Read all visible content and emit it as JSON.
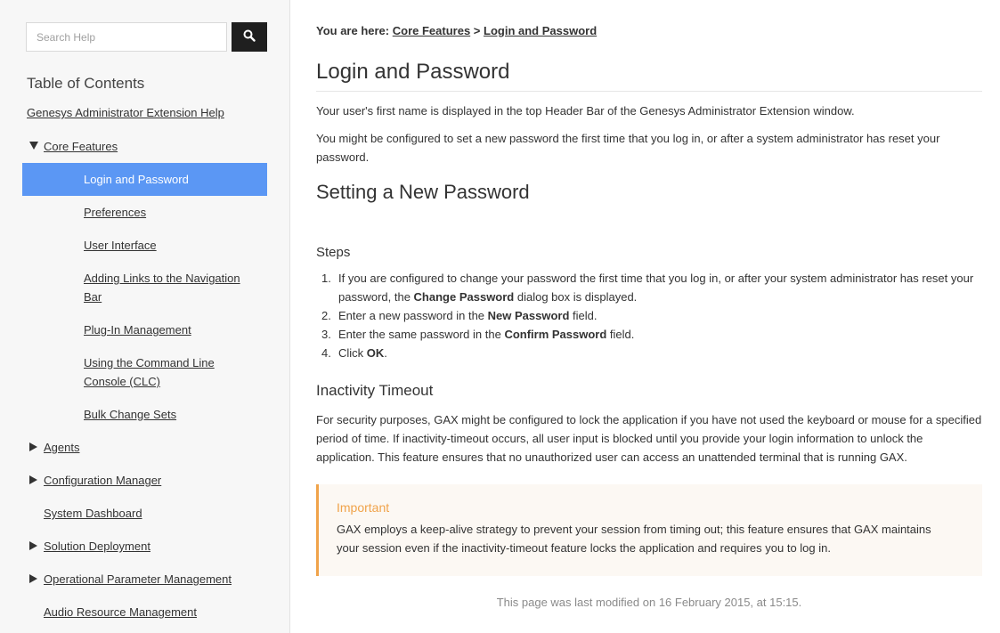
{
  "sidebar": {
    "search_placeholder": "Search Help",
    "search_icon": "search-icon",
    "toc_title": "Table of Contents",
    "root_link": "Genesys Administrator Extension Help",
    "core_features": "Core Features",
    "sub_items": [
      "Login and Password",
      "Preferences",
      "User Interface",
      "Adding Links to the Navigation Bar",
      "Plug-In Management",
      "Using the Command Line Console (CLC)",
      "Bulk Change Sets"
    ],
    "top_items": [
      "Agents",
      "Configuration Manager",
      "System Dashboard",
      "Solution Deployment",
      "Operational Parameter Management",
      "Audio Resource Management"
    ],
    "active_color": "#5b97f4"
  },
  "breadcrumb": {
    "prefix": "You are here:",
    "items": [
      "Core Features",
      "Login and Password"
    ],
    "separator": ">"
  },
  "main": {
    "title": "Login and Password",
    "intro_1": "Your user's first name is displayed in the top Header Bar of the Genesys Administrator Extension window.",
    "intro_2": "You might be configured to set a new password the first time that you log in, or after a system administrator has reset your password.",
    "section_title": "Setting a New Password",
    "steps_title": "Steps",
    "steps": [
      {
        "num": "1.",
        "pre": "If you are configured to change your password the first time that you log in, or after your system administrator has reset your password, the ",
        "bold": "Change Password",
        "post": " dialog box is displayed."
      },
      {
        "num": "2.",
        "pre": "Enter a new password in the ",
        "bold": "New Password",
        "post": " field."
      },
      {
        "num": "3.",
        "pre": "Enter the same password in the ",
        "bold": "Confirm Password",
        "post": " field."
      },
      {
        "num": "4.",
        "pre": "Click ",
        "bold": "OK",
        "post": "."
      }
    ],
    "inactivity_title": "Inactivity Timeout",
    "inactivity_text": "For security purposes, GAX might be configured to lock the application if you have not used the keyboard or mouse for a specified period of time. If inactivity-timeout occurs, all user input is blocked until you provide your login information to unlock the application. This feature ensures that no unauthorized user can access an unattended terminal that is running GAX.",
    "important_title": "Important",
    "important_text": "GAX employs a keep-alive strategy to prevent your session from timing out; this feature ensures that GAX maintains your session even if the inactivity-timeout feature locks the application and requires you to log in.",
    "important_color": "#f0a34a",
    "footer": "This page was last modified on 16 February 2015, at 15:15."
  }
}
